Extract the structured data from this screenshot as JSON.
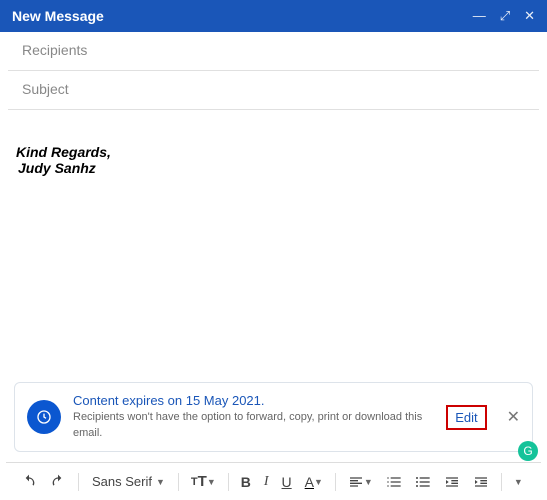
{
  "titlebar": {
    "title": "New Message"
  },
  "fields": {
    "recipients_placeholder": "Recipients",
    "subject_placeholder": "Subject"
  },
  "body": {
    "signature_line1": "Kind Regards,",
    "signature_line2": "Judy Sanhz"
  },
  "confidential": {
    "title": "Content expires on 15 May 2021.",
    "subtitle": "Recipients won't have the option to forward, copy, print or download this email.",
    "edit": "Edit"
  },
  "toolbar": {
    "font_family": "Sans Serif"
  }
}
